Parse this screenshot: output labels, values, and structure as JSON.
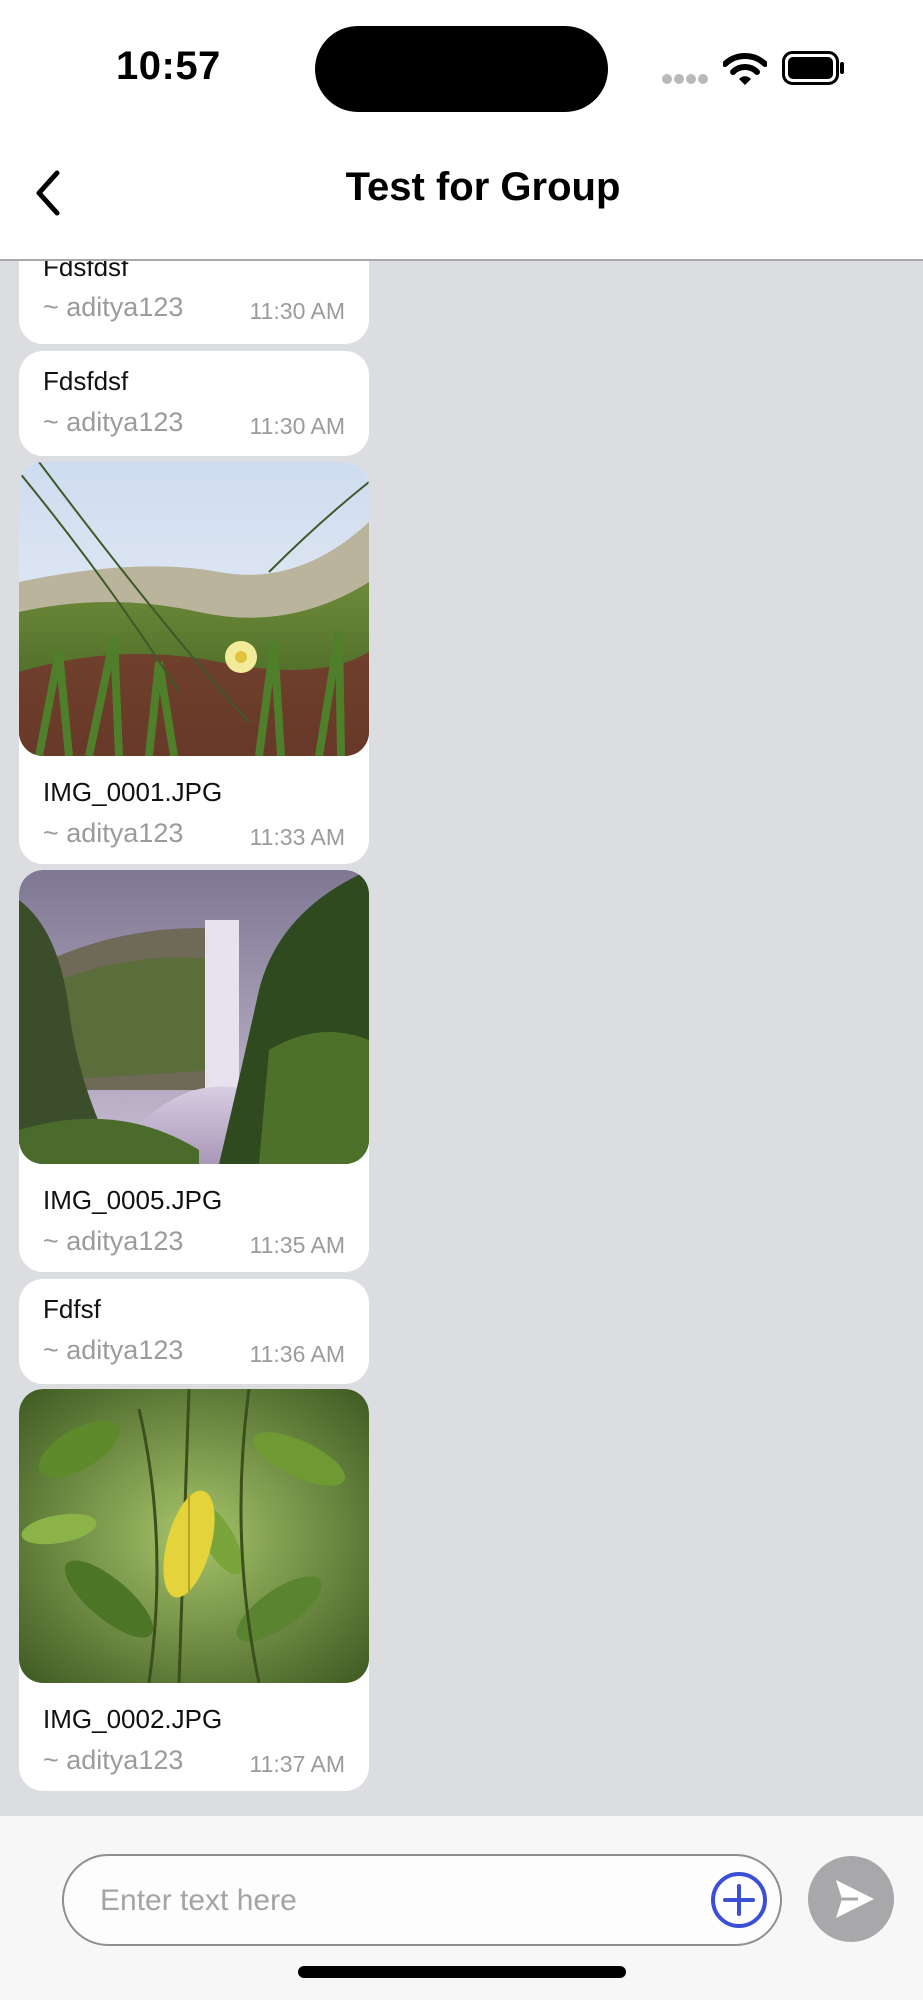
{
  "status_bar": {
    "time": "10:57"
  },
  "header": {
    "title": "Test for Group",
    "back_icon": "chevron-left-icon"
  },
  "messages": [
    {
      "type": "text",
      "text": "Fdsfdsf",
      "sender": "~ aditya123",
      "time": "11:30 AM"
    },
    {
      "type": "text",
      "text": "Fdsfdsf",
      "sender": "~ aditya123",
      "time": "11:30 AM"
    },
    {
      "type": "image",
      "image": "dune-flower-photo",
      "filename": "IMG_0001.JPG",
      "sender": "~ aditya123",
      "time": "11:33 AM"
    },
    {
      "type": "image",
      "image": "waterfall-photo",
      "filename": "IMG_0005.JPG",
      "sender": "~ aditya123",
      "time": "11:35 AM"
    },
    {
      "type": "text",
      "text": "Fdfsf",
      "sender": "~ aditya123",
      "time": "11:36 AM"
    },
    {
      "type": "image",
      "image": "green-leaves-photo",
      "filename": "IMG_0002.JPG",
      "sender": "~ aditya123",
      "time": "11:37 AM"
    }
  ],
  "composer": {
    "placeholder": "Enter text here",
    "add_icon": "plus-circle-icon",
    "send_icon": "send-icon",
    "accent_color": "#3a4fd6",
    "send_color": "#a8a8aa"
  },
  "colors": {
    "chat_background": "#dcdde0",
    "bubble": "#ffffff",
    "meta_text": "#9b9b9d"
  }
}
